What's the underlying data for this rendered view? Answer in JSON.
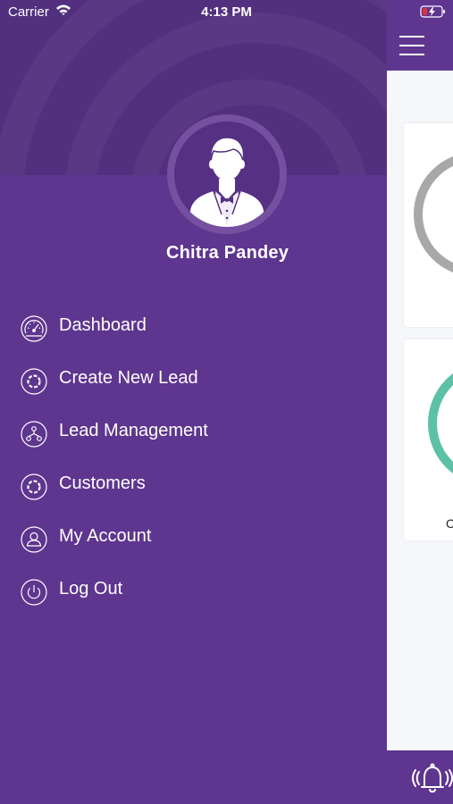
{
  "status_bar": {
    "carrier": "Carrier",
    "time": "4:13 PM"
  },
  "profile": {
    "name": "Chitra Pandey"
  },
  "menu": {
    "items": [
      {
        "label": "Dashboard",
        "icon": "speedometer-icon"
      },
      {
        "label": "Create New Lead",
        "icon": "aperture-icon"
      },
      {
        "label": "Lead Management",
        "icon": "hierarchy-icon"
      },
      {
        "label": "Customers",
        "icon": "aperture-icon"
      },
      {
        "label": "My Account",
        "icon": "user-icon"
      },
      {
        "label": "Log Out",
        "icon": "power-icon"
      }
    ]
  },
  "main": {
    "card2_label_partial": "C"
  },
  "colors": {
    "drawer_bg": "#5e358f",
    "header_bg": "#53307f",
    "gauge_gray": "#a8a8a8",
    "gauge_teal": "#5cc1a7",
    "battery_red": "#e0323c"
  }
}
